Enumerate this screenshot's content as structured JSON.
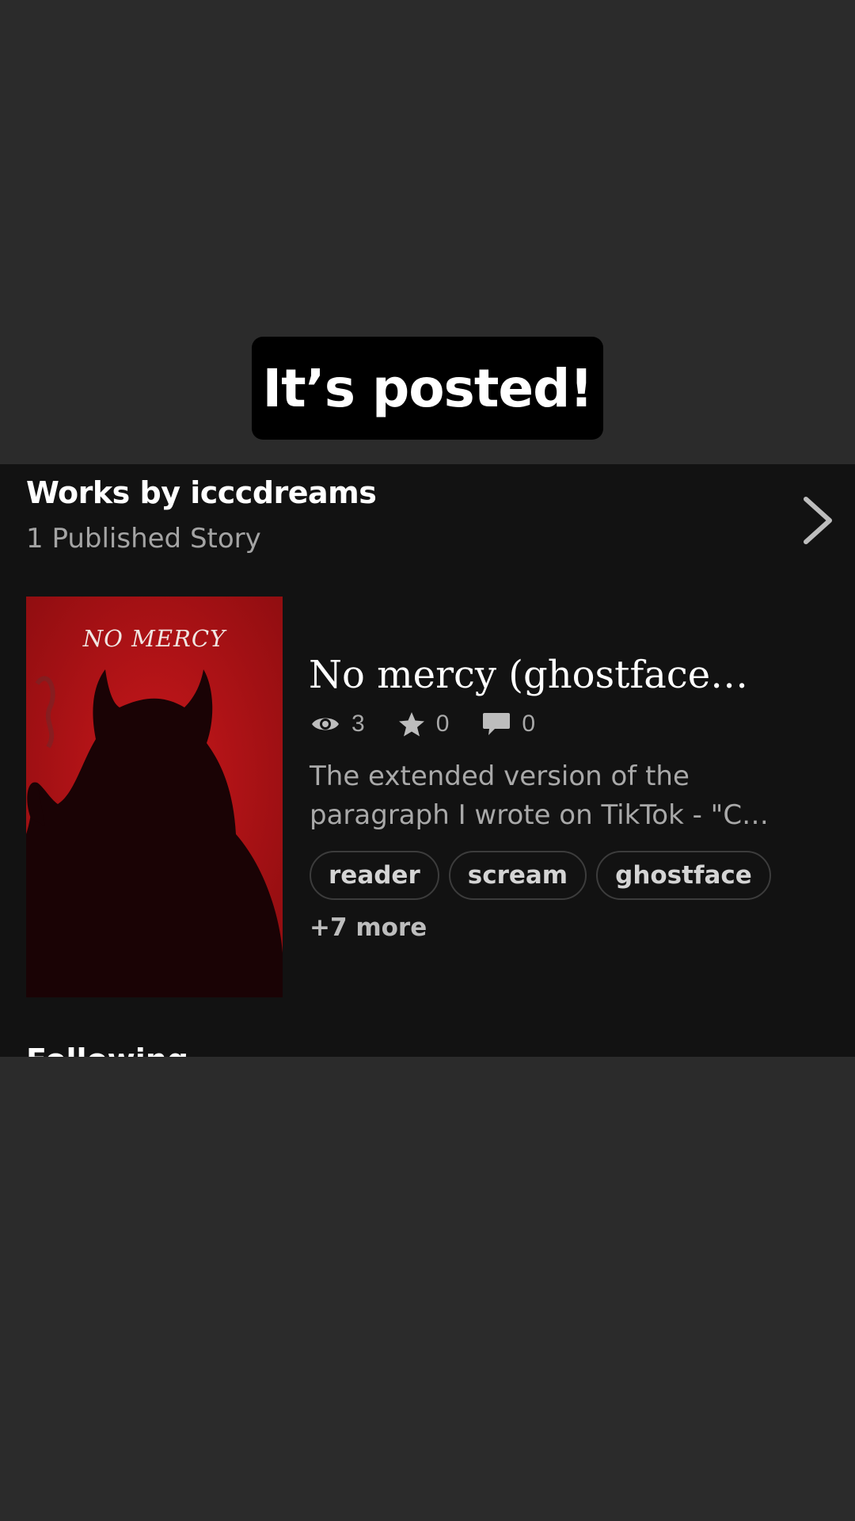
{
  "caption": "It’s posted!",
  "works": {
    "title": "Works by icccdreams",
    "subtitle": "1 Published Story"
  },
  "story": {
    "cover_title": "NO MERCY",
    "title": "No mercy (ghostface…",
    "stats": {
      "reads": "3",
      "votes": "0",
      "comments": "0"
    },
    "description": "The extended version of the paragraph I wrote on TikTok - \"C…",
    "tags": [
      "reader",
      "scream",
      "ghostface"
    ],
    "more_tags": "+7 more"
  },
  "next_section": {
    "title": "Following"
  },
  "icons": {
    "chevron": "chevron-right-icon",
    "reads": "eye-icon",
    "votes": "star-icon",
    "comments": "comment-icon"
  },
  "colors": {
    "background": "#2b2b2b",
    "panel": "#121212",
    "cover": "#b31317"
  }
}
